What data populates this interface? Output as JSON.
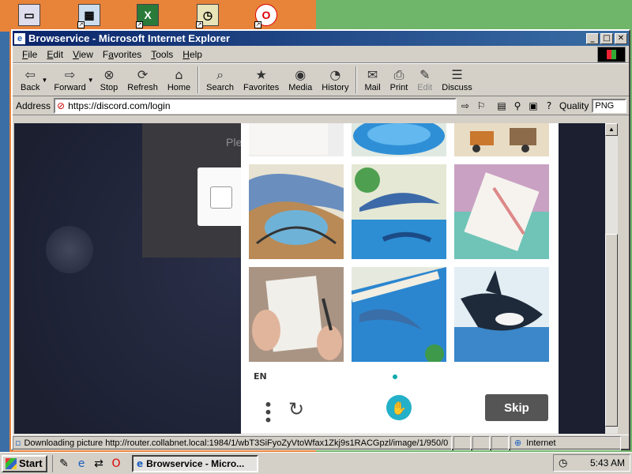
{
  "window": {
    "title": "Browservice - Microsoft Internet Explorer"
  },
  "menubar": [
    {
      "label": "File",
      "key": "F",
      "rest": "ile"
    },
    {
      "label": "Edit",
      "key": "E",
      "rest": "dit"
    },
    {
      "label": "View",
      "key": "V",
      "rest": "iew"
    },
    {
      "label": "Favorites",
      "key": "a",
      "pre": "F",
      "rest": "vorites"
    },
    {
      "label": "Tools",
      "key": "T",
      "rest": "ools"
    },
    {
      "label": "Help",
      "key": "H",
      "rest": "elp"
    }
  ],
  "toolbar": {
    "back": "Back",
    "forward": "Forward",
    "stop": "Stop",
    "refresh": "Refresh",
    "home": "Home",
    "search": "Search",
    "favorites": "Favorites",
    "media": "Media",
    "history": "History",
    "mail": "Mail",
    "print": "Print",
    "edit": "Edit",
    "discuss": "Discuss"
  },
  "address": {
    "label": "Address",
    "url": "https://discord.com/login",
    "quality_label": "Quality",
    "quality_value": "PNG"
  },
  "page": {
    "hint": "Ple"
  },
  "captcha": {
    "lang": "EN",
    "skip": "Skip"
  },
  "status": {
    "text": "Downloading picture http://router.collabnet.local:1984/1/wbT3SiFyoZyVtoWfax1Zkj9s1RACGpzl/image/1/950/0",
    "zone": "Internet"
  },
  "taskbar": {
    "start": "Start",
    "task": "Browservice - Micro...",
    "time": "5:43 AM"
  }
}
